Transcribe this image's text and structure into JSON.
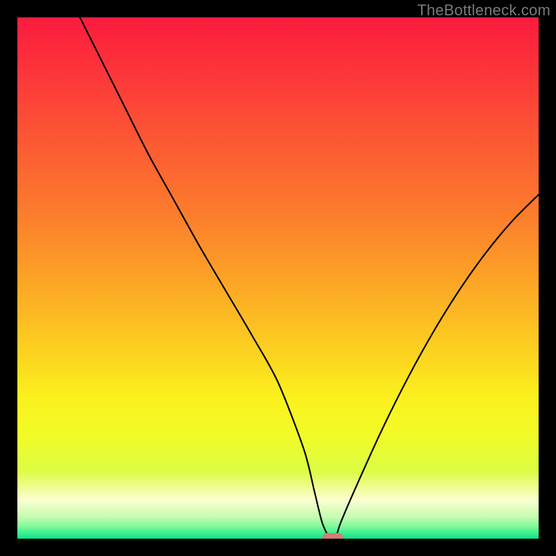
{
  "watermark": "TheBottleneck.com",
  "chart_data": {
    "type": "line",
    "title": "",
    "xlabel": "",
    "ylabel": "",
    "xlim": [
      0,
      100
    ],
    "ylim": [
      0,
      100
    ],
    "legend": null,
    "grid": false,
    "series": [
      {
        "name": "bottleneck-curve",
        "x": [
          12,
          15,
          20,
          25,
          30,
          35,
          40,
          45,
          50,
          55,
          57,
          58.5,
          60,
          61,
          62,
          65,
          70,
          75,
          80,
          85,
          90,
          95,
          100
        ],
        "y": [
          100,
          94,
          84,
          74,
          65,
          56,
          47.5,
          39,
          30,
          17,
          9,
          3,
          0,
          0,
          3,
          10,
          21,
          31,
          40,
          48,
          55,
          61,
          66
        ]
      }
    ],
    "marker": {
      "name": "optimal-point",
      "x": 60.5,
      "y": 0,
      "color": "#d77c74"
    },
    "background": {
      "type": "vertical-gradient",
      "stops": [
        {
          "pos": 0.0,
          "color": "#fb1b3e"
        },
        {
          "pos": 0.13,
          "color": "#fc3c39"
        },
        {
          "pos": 0.26,
          "color": "#fc5e32"
        },
        {
          "pos": 0.39,
          "color": "#fc802c"
        },
        {
          "pos": 0.5,
          "color": "#fca326"
        },
        {
          "pos": 0.58,
          "color": "#fcbd22"
        },
        {
          "pos": 0.66,
          "color": "#fcd81f"
        },
        {
          "pos": 0.73,
          "color": "#fbf11e"
        },
        {
          "pos": 0.8,
          "color": "#f2fb27"
        },
        {
          "pos": 0.87,
          "color": "#ddfc43"
        },
        {
          "pos": 0.926,
          "color": "#fbfed1"
        },
        {
          "pos": 0.958,
          "color": "#c6fcb1"
        },
        {
          "pos": 0.975,
          "color": "#87fa9d"
        },
        {
          "pos": 0.996,
          "color": "#1bea8c"
        },
        {
          "pos": 1.0,
          "color": "#0ee789"
        }
      ]
    }
  }
}
